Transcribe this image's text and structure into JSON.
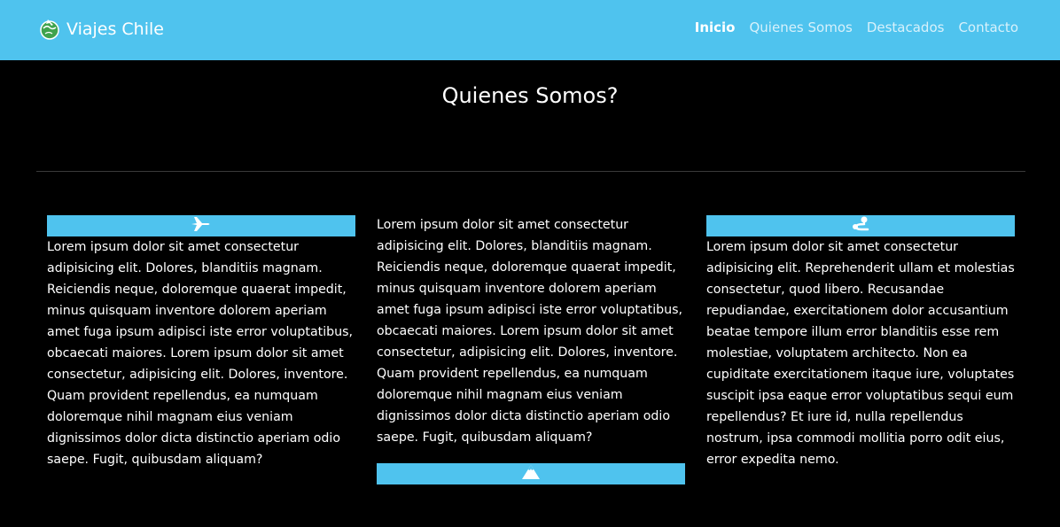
{
  "header": {
    "brand": "Viajes Chile",
    "brand_icon": "globe-travel-logo-icon",
    "colors": {
      "navbar": "#4fc3ee",
      "accent": "#4fc3ee",
      "background": "#000000"
    },
    "nav": [
      {
        "label": "Inicio",
        "active": true
      },
      {
        "label": "Quienes Somos",
        "active": false
      },
      {
        "label": "Destacados",
        "active": false
      },
      {
        "label": "Contacto",
        "active": false
      }
    ]
  },
  "section": {
    "title": "Quienes Somos?",
    "columns": [
      {
        "icon": "airplane-icon",
        "text": "Lorem ipsum dolor sit amet consectetur adipisicing elit. Dolores, blanditiis magnam. Reiciendis neque, doloremque quaerat impedit, minus quisquam inventore dolorem aperiam amet fuga ipsum adipisci iste error voluptatibus, obcaecati maiores. Lorem ipsum dolor sit amet consectetur, adipisicing elit. Dolores, inventore. Quam provident repellendus, ea numquam doloremque nihil magnam eius veniam dignissimos dolor dicta distinctio aperiam odio saepe. Fugit, quibusdam aliquam?"
      },
      {
        "icon": "mountain-icon",
        "text": "Lorem ipsum dolor sit amet consectetur adipisicing elit. Dolores, blanditiis magnam. Reiciendis neque, doloremque quaerat impedit, minus quisquam inventore dolorem aperiam amet fuga ipsum adipisci iste error voluptatibus, obcaecati maiores. Lorem ipsum dolor sit amet consectetur, adipisicing elit. Dolores, inventore. Quam provident repellendus, ea numquam doloremque nihil magnam eius veniam dignissimos dolor dicta distinctio aperiam odio saepe. Fugit, quibusdam aliquam?"
      },
      {
        "icon": "route-icon",
        "text": "Lorem ipsum dolor sit amet consectetur adipisicing elit. Reprehenderit ullam et molestias consectetur, quod libero. Recusandae repudiandae, exercitationem dolor accusantium beatae tempore illum error blanditiis esse rem molestiae, voluptatem architecto. Non ea cupiditate exercitationem itaque iure, voluptates suscipit ipsa eaque error voluptatibus sequi eum repellendus? Et iure id, nulla repellendus nostrum, ipsa commodi mollitia porro odit eius, error expedita nemo."
      }
    ]
  }
}
